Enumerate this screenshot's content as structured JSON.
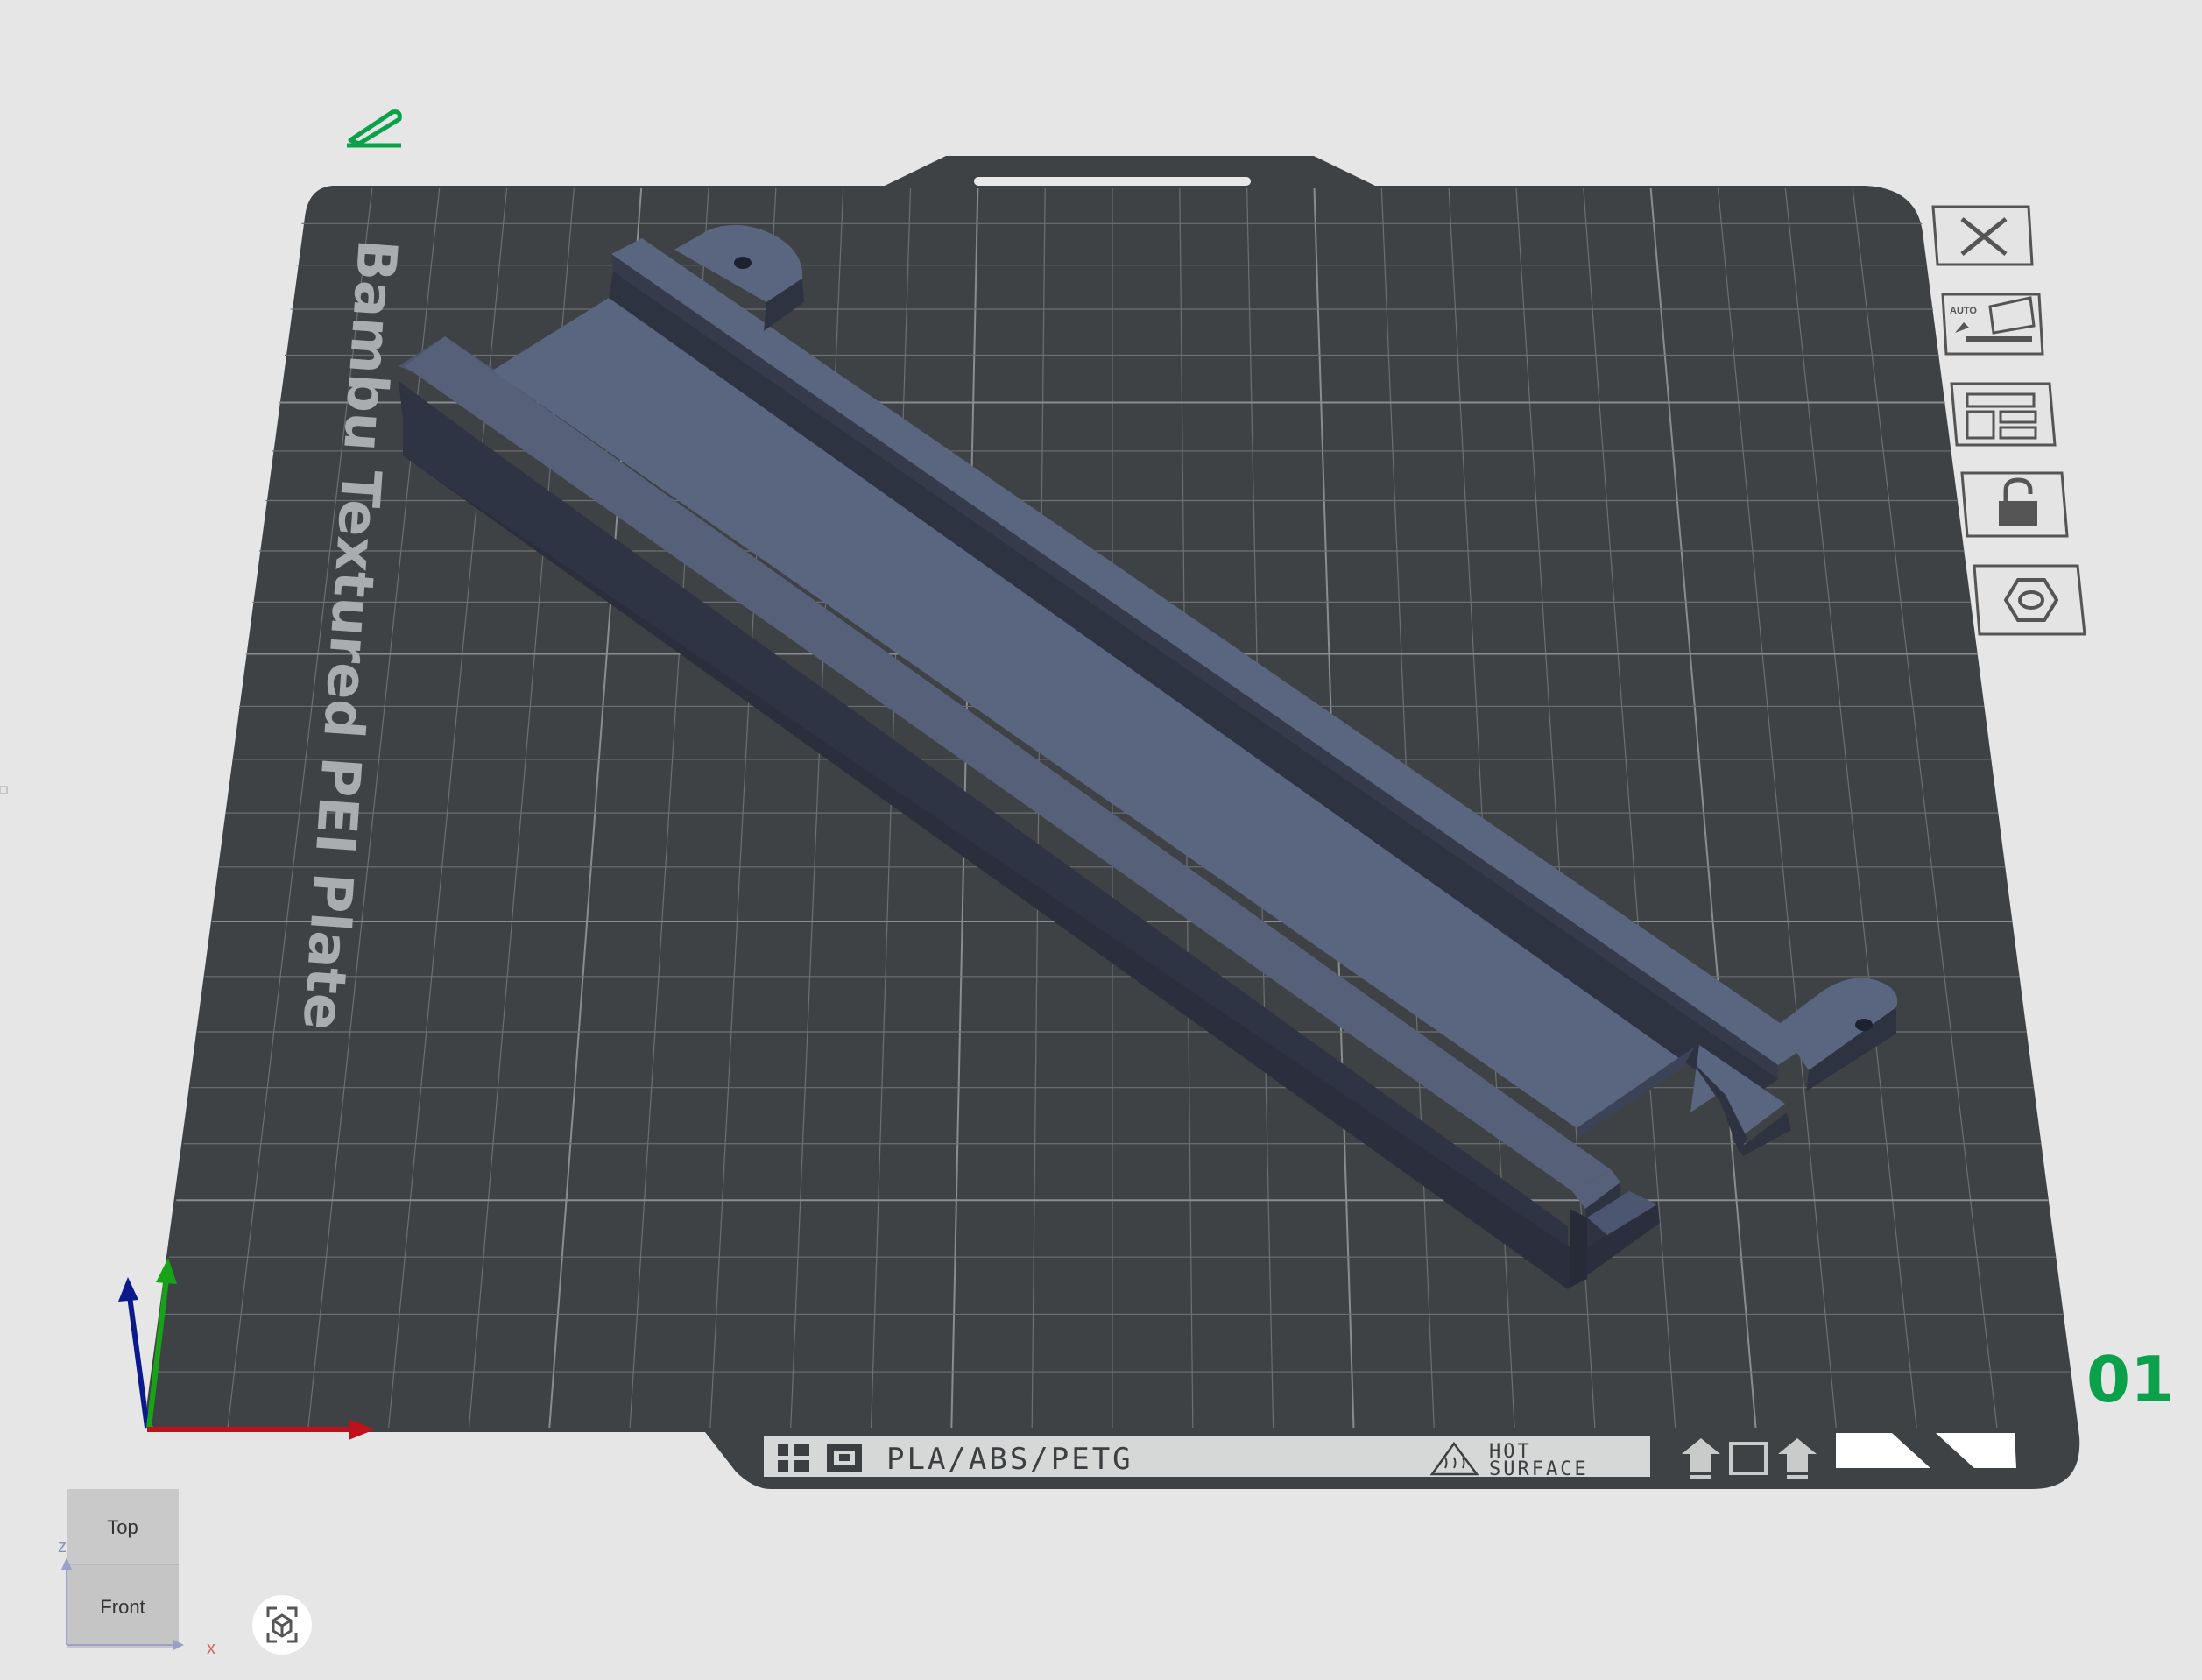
{
  "plate": {
    "name": "Bambu Textured PEI Plate",
    "number": "01",
    "material_label": "PLA/ABS/PETG",
    "hot_surface_line1": "HOT",
    "hot_surface_line2": "SURFACE"
  },
  "plate_toolbar": [
    {
      "name": "close-plate-button",
      "icon": "close-icon"
    },
    {
      "name": "auto-orient-button",
      "icon": "auto-orient-icon",
      "text": "AUTO"
    },
    {
      "name": "arrange-button",
      "icon": "arrange-icon"
    },
    {
      "name": "lock-plate-button",
      "icon": "unlock-icon"
    },
    {
      "name": "plate-settings-button",
      "icon": "gear-icon"
    }
  ],
  "top_left": {
    "icon": "edit-plate-name-icon"
  },
  "view_cube": {
    "top_label": "Top",
    "front_label": "Front",
    "x_label": "x",
    "z_label": "z"
  },
  "camera_button": {
    "icon": "camera-view-icon"
  },
  "colors": {
    "background": "#e6e6e6",
    "plate": "#3f4244",
    "grid": "#7a7d7f",
    "model_top": "#5a6580",
    "model_side": "#2e3342",
    "accent_green": "#0aa14a",
    "axis_x": "#c0101a",
    "axis_y": "#17a317",
    "axis_z": "#0a1a8a"
  }
}
